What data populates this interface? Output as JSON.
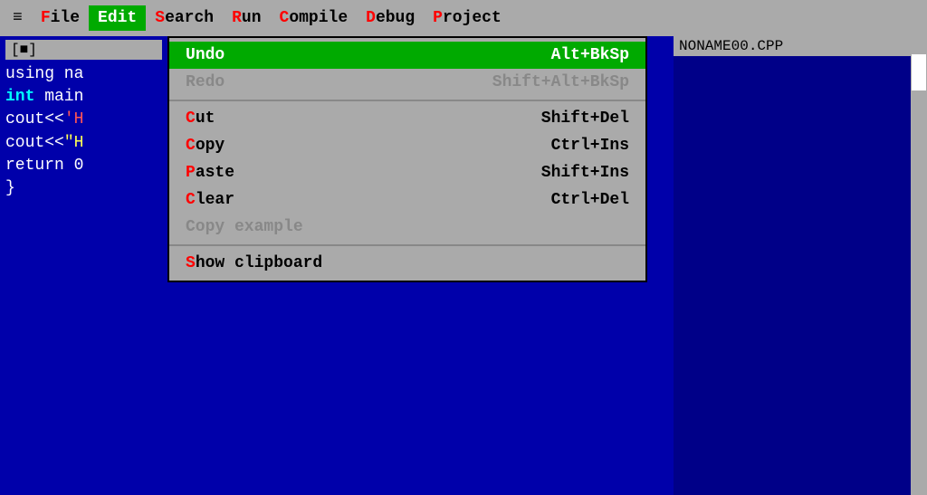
{
  "menubar": {
    "hamburger": "≡",
    "items": [
      {
        "id": "file",
        "label": "File",
        "first": "F",
        "rest": "ile",
        "active": false
      },
      {
        "id": "edit",
        "label": "Edit",
        "first": "E",
        "rest": "dit",
        "active": true
      },
      {
        "id": "search",
        "label": "Search",
        "first": "S",
        "rest": "earch",
        "active": false
      },
      {
        "id": "run",
        "label": "Run",
        "first": "R",
        "rest": "un",
        "active": false
      },
      {
        "id": "compile",
        "label": "Compile",
        "first": "C",
        "rest": "ompile",
        "active": false
      },
      {
        "id": "debug",
        "label": "Debug",
        "first": "D",
        "rest": "ebug",
        "active": false
      },
      {
        "id": "project",
        "label": "Project",
        "first": "P",
        "rest": "roject",
        "active": false
      }
    ]
  },
  "editor": {
    "title": "[■]",
    "lines": [
      {
        "text": "using na",
        "type": "mixed"
      },
      {
        "text": "int main",
        "type": "keyword-white"
      },
      {
        "text": "cout<<'H",
        "type": "mixed"
      },
      {
        "text": "cout<<\"H",
        "type": "mixed"
      },
      {
        "text": "return 0",
        "type": "mixed"
      },
      {
        "text": "}",
        "type": "white"
      }
    ]
  },
  "noname": {
    "title": "NONAME00.CPP"
  },
  "dropdown": {
    "sections": [
      {
        "items": [
          {
            "id": "undo",
            "first": "U",
            "rest": "ndo",
            "shortcut": "Alt+BkSp",
            "disabled": false,
            "highlighted": true
          },
          {
            "id": "redo",
            "first": "R",
            "rest": "edo",
            "shortcut": "Shift+Alt+BkSp",
            "disabled": true,
            "highlighted": false
          }
        ]
      },
      {
        "items": [
          {
            "id": "cut",
            "first": "C",
            "rest": "ut",
            "shortcut": "Shift+Del",
            "disabled": false,
            "highlighted": false
          },
          {
            "id": "copy",
            "first": "C",
            "rest": "opy",
            "shortcut": "Ctrl+Ins",
            "disabled": false,
            "highlighted": false
          },
          {
            "id": "paste",
            "first": "P",
            "rest": "aste",
            "shortcut": "Shift+Ins",
            "disabled": false,
            "highlighted": false
          },
          {
            "id": "clear",
            "first": "C",
            "rest": "lear",
            "shortcut": "Ctrl+Del",
            "disabled": false,
            "highlighted": false
          },
          {
            "id": "copy-example",
            "first": "",
            "rest": "Copy example",
            "shortcut": "",
            "disabled": true,
            "highlighted": false
          }
        ]
      },
      {
        "items": [
          {
            "id": "show-clipboard",
            "first": "S",
            "rest": "how clipboard",
            "shortcut": "",
            "disabled": false,
            "highlighted": false
          }
        ]
      }
    ]
  }
}
